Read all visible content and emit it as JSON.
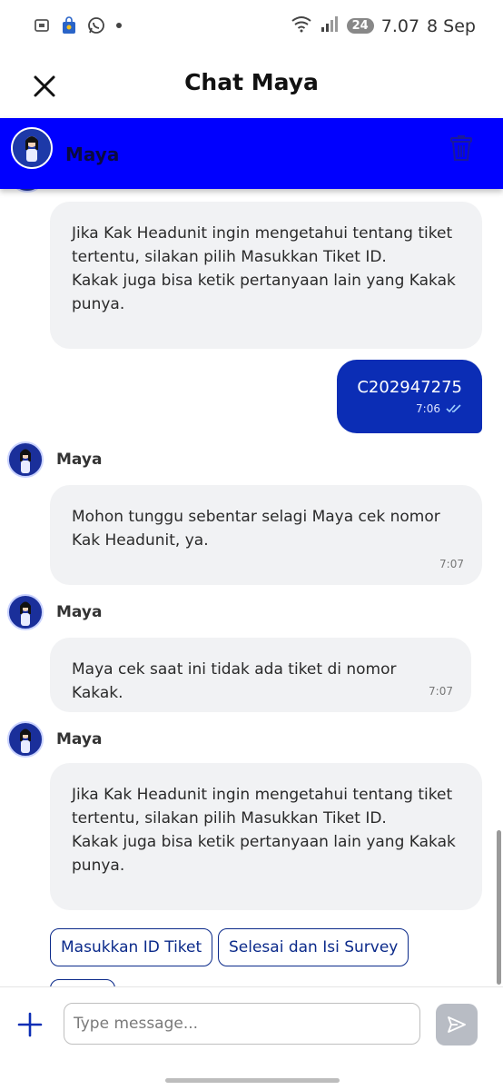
{
  "status_bar": {
    "time": "7.07",
    "date": "8 Sep",
    "battery": "24",
    "network": "5"
  },
  "header": {
    "title": "Chat Maya"
  },
  "banner": {
    "name": "Maya",
    "color": "#0000ff"
  },
  "messages": [
    {
      "type": "bot",
      "text": "Jika Kak Headunit ingin mengetahui tentang tiket tertentu, silakan pilih Masukkan Tiket ID.\nKakak juga bisa ketik pertanyaan lain yang Kakak punya."
    },
    {
      "type": "user",
      "text": "C202947275",
      "time": "7:06"
    },
    {
      "type": "bot",
      "sender": "Maya",
      "text": "Mohon tunggu sebentar selagi Maya cek nomor Kak Headunit, ya.",
      "time": "7:07"
    },
    {
      "type": "bot",
      "sender": "Maya",
      "text": "Maya cek saat ini tidak ada tiket di nomor Kakak.",
      "time": "7:07"
    },
    {
      "type": "bot",
      "sender": "Maya",
      "text": "Jika Kak Headunit ingin mengetahui tentang tiket tertentu, silakan pilih Masukkan Tiket ID.\nKakak juga bisa ketik pertanyaan lain yang Kakak punya."
    }
  ],
  "quick_replies": [
    "Masukkan ID Tiket",
    "Selesai dan Isi Survey"
  ],
  "composer": {
    "placeholder": "Type message..."
  },
  "colors": {
    "accent": "#0b2db5",
    "bubble_bg": "#f1f2f4"
  },
  "icons": {
    "close": "close-icon",
    "trash": "trash-icon",
    "plus": "plus-icon",
    "send": "send-icon",
    "read": "double-check-icon"
  }
}
